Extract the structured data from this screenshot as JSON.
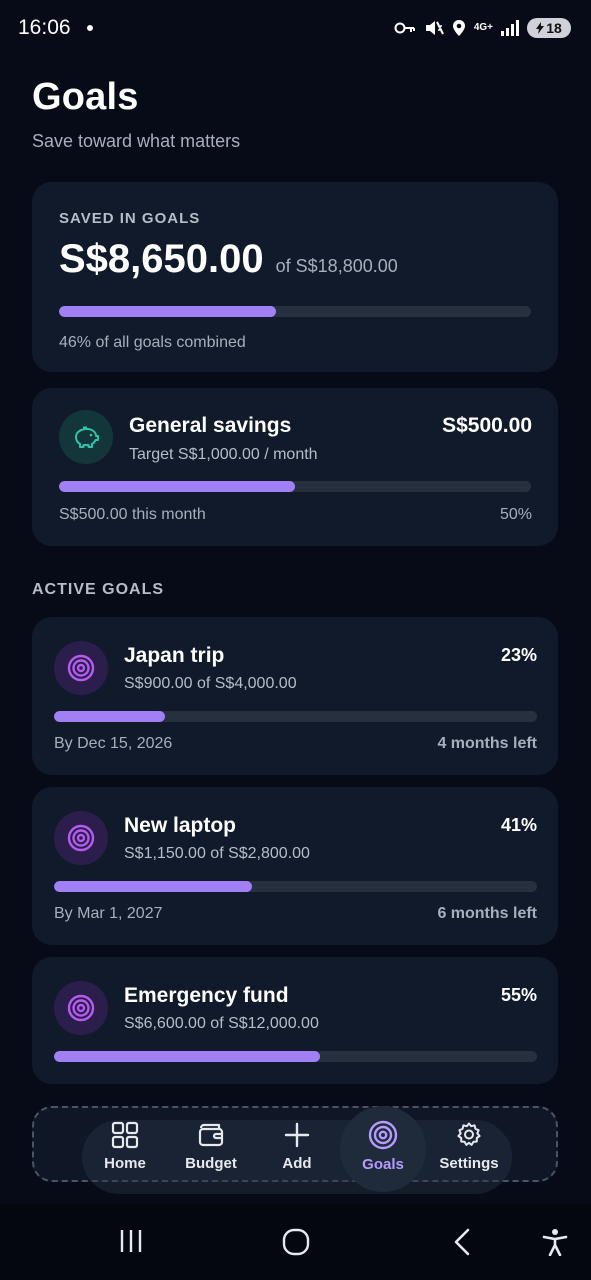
{
  "status_bar": {
    "time": "16:06",
    "network": "4G+",
    "battery": "18"
  },
  "header": {
    "title": "Goals",
    "subtitle": "Save toward what matters"
  },
  "summary": {
    "label": "SAVED IN GOALS",
    "amount": "S$8,650.00",
    "of_total": "of S$18,800.00",
    "progress_fraction": 0.46,
    "caption": "46% of all goals combined"
  },
  "general_savings": {
    "icon": "piggy-bank-icon",
    "name": "General savings",
    "target": "Target S$1,000.00 / month",
    "amount": "S$500.00",
    "progress_fraction": 0.5,
    "this_month": "S$500.00 this month",
    "percent": "50%"
  },
  "section": {
    "active_goals_label": "ACTIVE GOALS"
  },
  "goals": [
    {
      "icon": "target-icon",
      "name": "Japan trip",
      "progress_text": "S$900.00 of S$4,000.00",
      "percent": "23%",
      "progress_fraction": 0.23,
      "date": "By Dec 15, 2026",
      "time_left": "4 months left"
    },
    {
      "icon": "target-icon",
      "name": "New laptop",
      "progress_text": "S$1,150.00 of S$2,800.00",
      "percent": "41%",
      "progress_fraction": 0.41,
      "date": "By Mar 1, 2027",
      "time_left": "6 months left"
    },
    {
      "icon": "target-icon",
      "name": "Emergency fund",
      "progress_text": "S$6,600.00 of S$12,000.00",
      "percent": "55%",
      "progress_fraction": 0.55,
      "date": "",
      "time_left": ""
    }
  ],
  "nav": {
    "items": [
      {
        "label": "Home",
        "icon": "grid-icon"
      },
      {
        "label": "Budget",
        "icon": "wallet-icon"
      },
      {
        "label": "Add",
        "icon": "plus-icon"
      },
      {
        "label": "Goals",
        "icon": "target-icon",
        "active": true
      },
      {
        "label": "Settings",
        "icon": "gear-icon"
      }
    ],
    "accent_color": "#b79aff"
  },
  "colors": {
    "background": "#060b17",
    "card": "#111a2b",
    "progress_fill": "#a17ff5",
    "progress_track": "#27303f"
  }
}
